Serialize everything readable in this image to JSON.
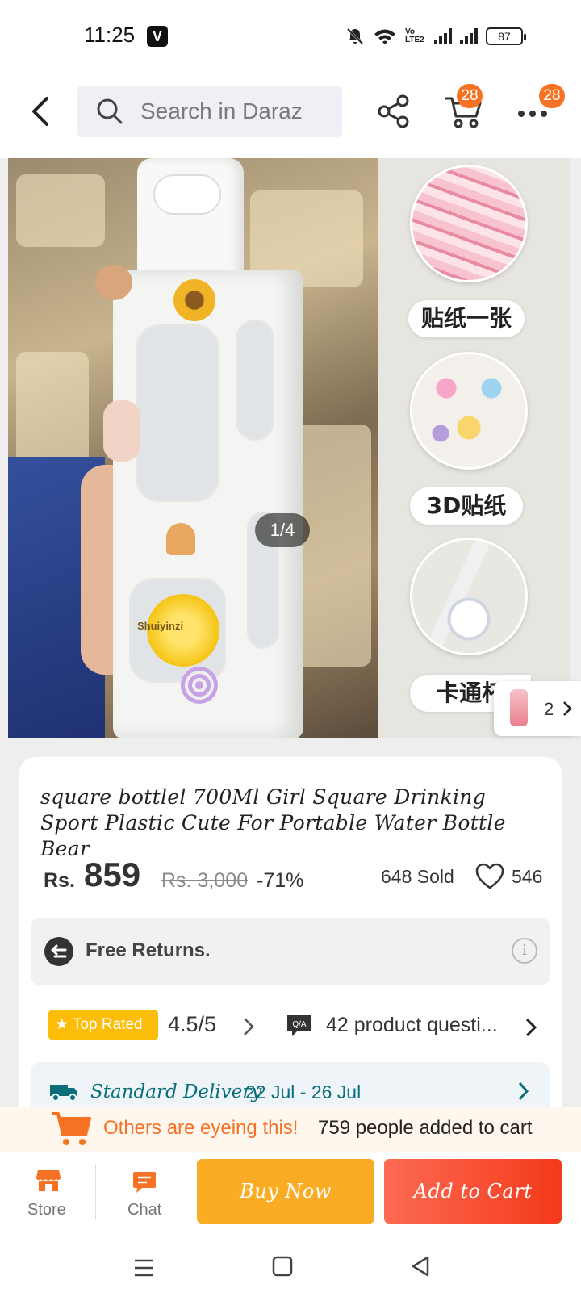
{
  "status_bar": {
    "time": "11:25",
    "app_badge": "V",
    "volte": "Vo LTE2",
    "battery": "87"
  },
  "header": {
    "search_placeholder": "Search in Daraz",
    "cart_badge": "28",
    "more_badge": "28"
  },
  "gallery": {
    "counter": "1/4",
    "thumb_count": "2",
    "bottle_brand": "Shuiyinzi",
    "labels": [
      "贴纸一张",
      "3D贴纸",
      "卡通杯"
    ]
  },
  "product": {
    "title": "square bottlel 700Ml Girl Square Drinking Sport Plastic Cute For Portable Water Bottle Bear",
    "currency": "Rs.",
    "price": "859",
    "original_price": "Rs. 3,000",
    "discount": "-71%",
    "sold": "648 Sold",
    "likes": "546",
    "returns": "Free Returns.",
    "top_rated": "Top Rated",
    "rating": "4.5/5",
    "qa_badge": "Q/A",
    "questions": "42 product questi...",
    "delivery_label": "Standard Delivery",
    "delivery_date": "22 Jul - 26 Jul"
  },
  "eyeing": {
    "text": "Others are eyeing this!",
    "count": "759 people added to cart"
  },
  "actions": {
    "store": "Store",
    "chat": "Chat",
    "buy_now": "Buy Now",
    "add_to_cart": "Add to Cart"
  },
  "colors": {
    "brand_orange": "#f57224",
    "buy_now": "#fbac25",
    "add_to_cart": "#f4391a",
    "top_rated": "#fbbd08",
    "delivery_text": "#0a6f7a"
  },
  "icons": [
    "back-arrow-icon",
    "search-icon",
    "share-icon",
    "cart-icon",
    "more-icon",
    "heart-icon",
    "return-icon",
    "info-icon",
    "star-icon",
    "qa-icon",
    "truck-icon",
    "store-icon",
    "chat-icon"
  ]
}
